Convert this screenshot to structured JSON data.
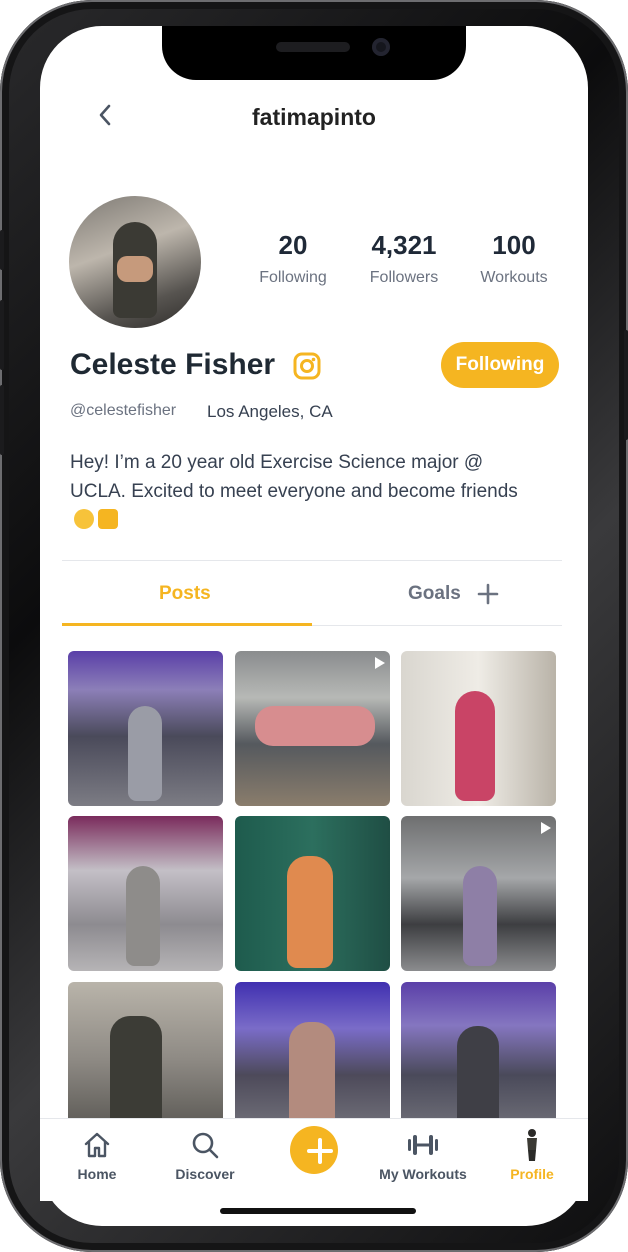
{
  "header": {
    "username": "fatimapinto"
  },
  "profile": {
    "name": "Celeste Fisher",
    "handle": "@celestefisher",
    "location": "Los Angeles, CA",
    "bio": "Hey! I’m a 20 year old Exercise Science major @ UCLA. Excited to meet everyone and become friends",
    "follow_label": "Following"
  },
  "stats": [
    {
      "value": "20",
      "label": "Following"
    },
    {
      "value": "4,321",
      "label": "Followers"
    },
    {
      "value": "100",
      "label": "Workouts"
    }
  ],
  "tabs": {
    "posts": "Posts",
    "goals": "Goals"
  },
  "posts": [
    {
      "video": false
    },
    {
      "video": true
    },
    {
      "video": false
    },
    {
      "video": false
    },
    {
      "video": false
    },
    {
      "video": true
    },
    {
      "video": false
    },
    {
      "video": false
    },
    {
      "video": false
    }
  ],
  "nav": {
    "home": "Home",
    "discover": "Discover",
    "my_workouts": "My Workouts",
    "profile": "Profile"
  },
  "colors": {
    "accent": "#f5b521",
    "text": "#1f2933",
    "muted": "#6b7280"
  }
}
